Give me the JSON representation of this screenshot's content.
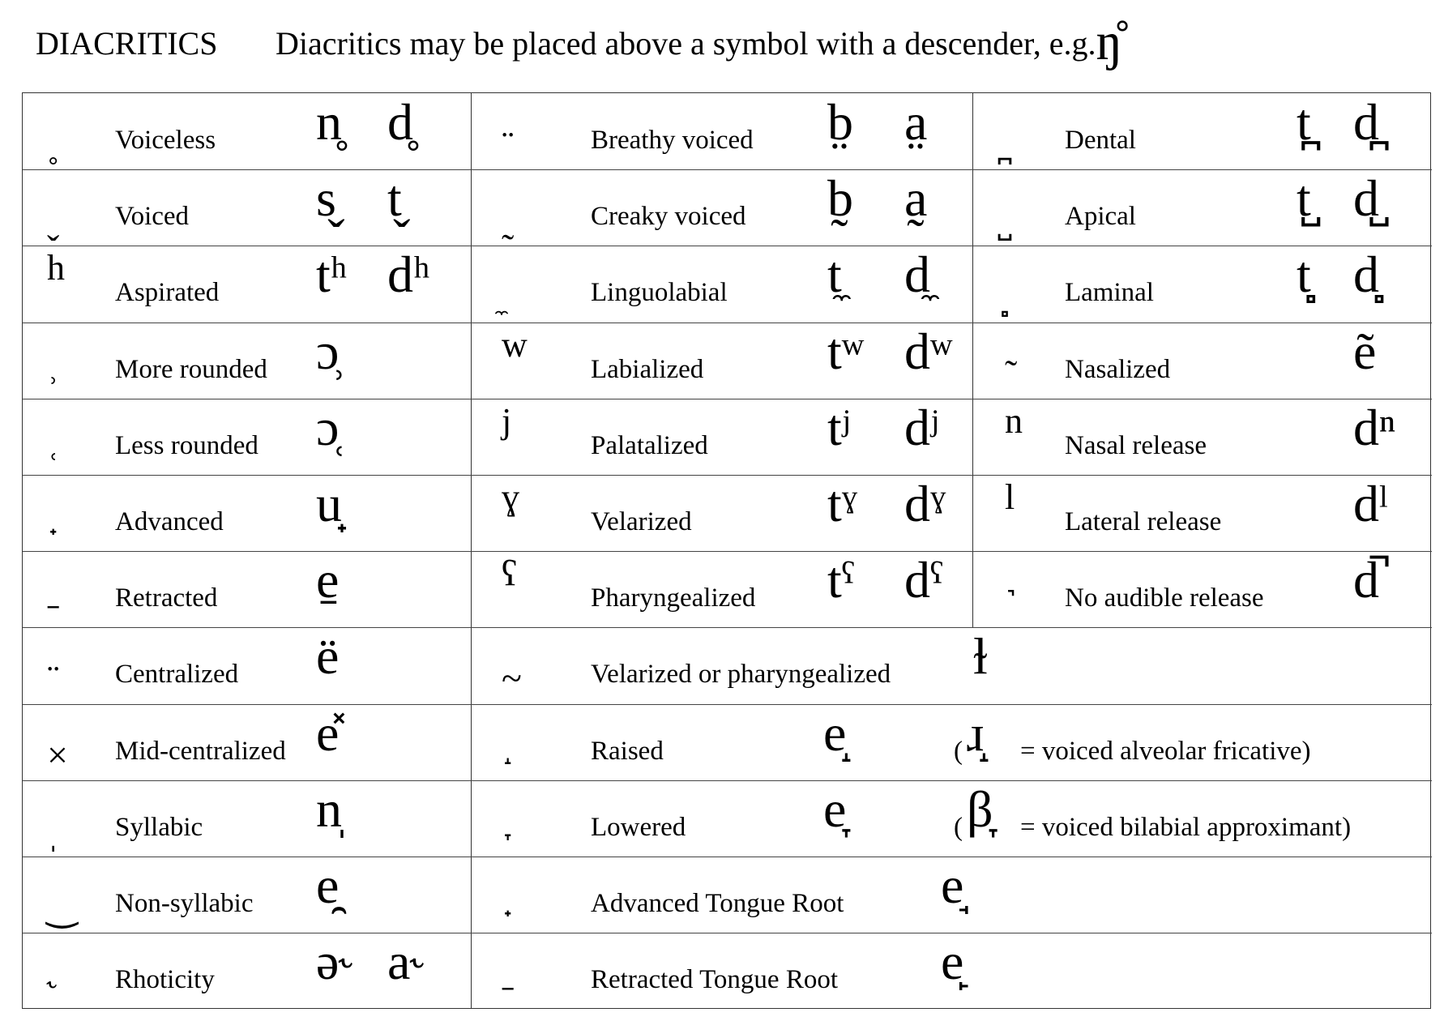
{
  "header": {
    "title": "DIACRITICS",
    "description": "Diacritics may be placed above a symbol with a descender, e.g.",
    "example": "ŋ̊"
  },
  "left_column": [
    {
      "mark": "̥",
      "mark_display": "˳",
      "label": "Voiceless",
      "examples": [
        "n̥",
        "d̥"
      ]
    },
    {
      "mark": "̬",
      "mark_display": "ˬ",
      "label": "Voiced",
      "examples": [
        "s̬",
        "t̬"
      ]
    },
    {
      "mark": "ʰ",
      "mark_display": "h",
      "label": "Aspirated",
      "examples": [
        "tʰ",
        "dʰ"
      ]
    },
    {
      "mark": "̹",
      "mark_display": "˒",
      "label": "More rounded",
      "examples": [
        "ɔ̹"
      ]
    },
    {
      "mark": "̜",
      "mark_display": "˓",
      "label": "Less rounded",
      "examples": [
        "ɔ̜"
      ]
    },
    {
      "mark": "̟",
      "mark_display": "˖",
      "label": "Advanced",
      "examples": [
        "u̟"
      ]
    },
    {
      "mark": "̠",
      "mark_display": "˗",
      "label": "Retracted",
      "examples": [
        "e̠"
      ]
    },
    {
      "mark": "̈",
      "mark_display": "¨",
      "label": "Centralized",
      "examples": [
        "ë"
      ]
    },
    {
      "mark": "̽",
      "mark_display": "×",
      "label": "Mid-centralized",
      "examples": [
        "e̽"
      ]
    },
    {
      "mark": "̩",
      "mark_display": "ˌ",
      "label": "Syllabic",
      "examples": [
        "n̩"
      ]
    },
    {
      "mark": "̯",
      "mark_display": "‿",
      "label": "Non-syllabic",
      "examples": [
        "e̯"
      ]
    },
    {
      "mark": "˞",
      "mark_display": "˞",
      "label": "Rhoticity",
      "examples": [
        "ə˞",
        "a˞"
      ]
    }
  ],
  "middle_column": [
    {
      "mark_display": "¨",
      "label": "Breathy voiced",
      "examples": [
        "b̤",
        "a̤"
      ]
    },
    {
      "mark_display": "˷",
      "label": "Creaky voiced",
      "examples": [
        "b̰",
        "a̰"
      ]
    },
    {
      "mark_display": "̼",
      "label": "Linguolabial",
      "examples": [
        "t̼",
        "d̼"
      ]
    },
    {
      "mark_display": "w",
      "label": "Labialized",
      "examples": [
        "tʷ",
        "dʷ"
      ]
    },
    {
      "mark_display": "j",
      "label": "Palatalized",
      "examples": [
        "tʲ",
        "dʲ"
      ]
    },
    {
      "mark_display": "ɣ",
      "label": "Velarized",
      "examples": [
        "tˠ",
        "dˠ"
      ]
    },
    {
      "mark_display": "ʕ",
      "label": "Pharyngealized",
      "examples": [
        "tˤ",
        "dˤ"
      ]
    }
  ],
  "right_column": [
    {
      "mark_display": "̪",
      "label": "Dental",
      "examples": [
        "t̪",
        "d̪"
      ]
    },
    {
      "mark_display": "̺",
      "label": "Apical",
      "examples": [
        "t̺",
        "d̺"
      ]
    },
    {
      "mark_display": "̻",
      "label": "Laminal",
      "examples": [
        "t̻",
        "d̻"
      ]
    },
    {
      "mark_display": "˜",
      "label": "Nasalized",
      "examples": [
        "ẽ"
      ]
    },
    {
      "mark_display": "n",
      "label": "Nasal release",
      "examples": [
        "dⁿ"
      ]
    },
    {
      "mark_display": "l",
      "label": "Lateral release",
      "examples": [
        "dˡ"
      ]
    },
    {
      "mark_display": "˺",
      "label": "No audible release",
      "examples": [
        "d̚"
      ]
    }
  ],
  "wide_rows": [
    {
      "mark_display": "~",
      "label": "Velarized or pharyngealized",
      "examples": [
        "ɫ"
      ],
      "note": ""
    },
    {
      "mark_display": "˔",
      "label": "Raised",
      "examples": [
        "e̝"
      ],
      "note_symbol": "ɹ̝",
      "note": "= voiced alveolar fricative)"
    },
    {
      "mark_display": "˕",
      "label": "Lowered",
      "examples": [
        "e̞"
      ],
      "note_symbol": "β̞",
      "note": "= voiced bilabial approximant)"
    },
    {
      "mark_display": "˖",
      "label": "Advanced Tongue Root",
      "examples": [
        "e̘"
      ],
      "note": ""
    },
    {
      "mark_display": "˗",
      "label": "Retracted Tongue Root",
      "examples": [
        "e̙"
      ],
      "note": ""
    }
  ],
  "paren_open": "("
}
